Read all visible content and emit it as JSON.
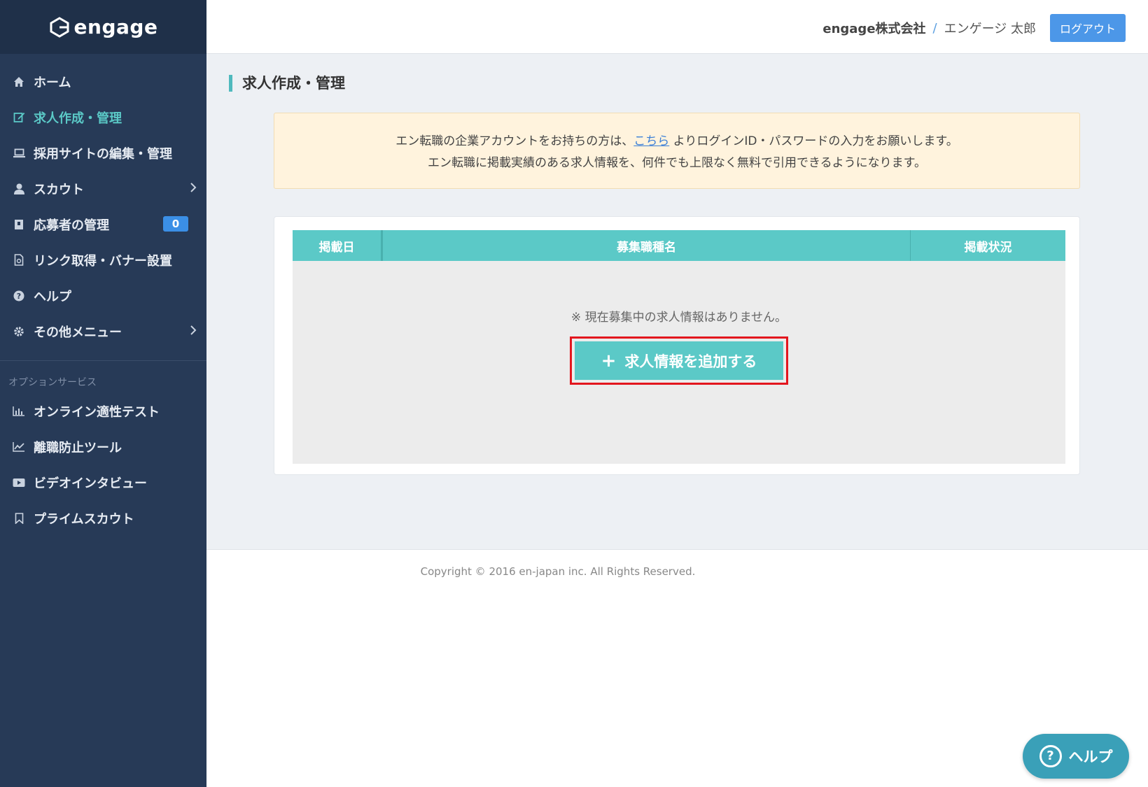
{
  "app": {
    "logo_text": "engage"
  },
  "header": {
    "company": "engage株式会社",
    "separator": "/",
    "user": "エンゲージ 太郎",
    "logout_label": "ログアウト"
  },
  "sidebar": {
    "items": [
      {
        "label": "ホーム",
        "icon": "home-icon"
      },
      {
        "label": "求人作成・管理",
        "icon": "edit-icon",
        "active": true
      },
      {
        "label": "採用サイトの編集・管理",
        "icon": "laptop-icon"
      },
      {
        "label": "スカウト",
        "icon": "user-icon"
      },
      {
        "label": "応募者の管理",
        "icon": "id-card-icon",
        "badge": "0"
      },
      {
        "label": "リンク取得・バナー設置",
        "icon": "link-doc-icon"
      },
      {
        "label": "ヘルプ",
        "icon": "question-icon"
      },
      {
        "label": "その他メニュー",
        "icon": "gear-icon"
      }
    ],
    "section_label": "オプションサービス",
    "option_items": [
      {
        "label": "オンライン適性テスト",
        "icon": "bar-chart-icon"
      },
      {
        "label": "離職防止ツール",
        "icon": "line-chart-icon"
      },
      {
        "label": "ビデオインタビュー",
        "icon": "video-icon"
      },
      {
        "label": "プライムスカウト",
        "icon": "bookmark-icon"
      }
    ]
  },
  "main": {
    "page_title": "求人作成・管理",
    "notice": {
      "line1_before": "エン転職の企業アカウントをお持ちの方は、",
      "line1_link": "こちら",
      "line1_after": " よりログインID・パスワードの入力をお願いします。",
      "line2": "エン転職に掲載実績のある求人情報を、何件でも上限なく無料で引用できるようになります。"
    },
    "table": {
      "columns": [
        "掲載日",
        "募集職種名",
        "掲載状況"
      ],
      "empty_message": "※ 現在募集中の求人情報はありません。",
      "add_button": "求人情報を追加する"
    }
  },
  "footer": {
    "copyright": "Copyright © 2016 en-japan inc. All Rights Reserved."
  },
  "help_fab": {
    "label": "ヘルプ"
  },
  "colors": {
    "sidebar": "#273a57",
    "accent": "#5bc9c7",
    "highlight": "#e3161e"
  }
}
